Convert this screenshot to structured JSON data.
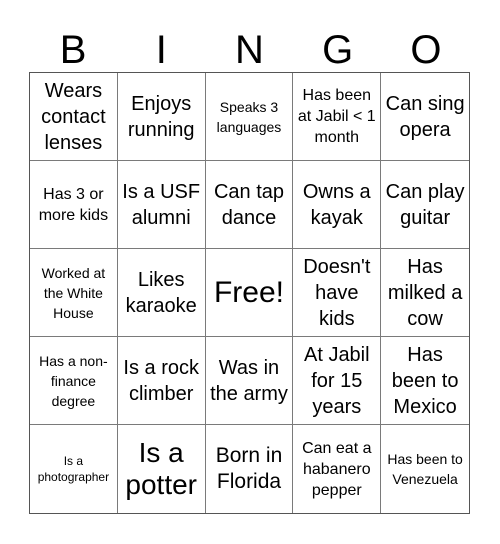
{
  "title": {
    "letters": [
      "B",
      "I",
      "N",
      "G",
      "O"
    ]
  },
  "board": {
    "rows": [
      [
        {
          "text": "Wears contact lenses",
          "size": "s-md"
        },
        {
          "text": "Enjoys running",
          "size": "s-md"
        },
        {
          "text": "Speaks 3 languages",
          "size": "s-xs"
        },
        {
          "text": "Has been at Jabil < 1 month",
          "size": "s-sm"
        },
        {
          "text": "Can sing opera",
          "size": "s-md"
        }
      ],
      [
        {
          "text": "Has 3 or more kids",
          "size": "s-sm"
        },
        {
          "text": "Is a USF alumni",
          "size": "s-md"
        },
        {
          "text": "Can tap dance",
          "size": "s-md"
        },
        {
          "text": "Owns a kayak",
          "size": "s-md"
        },
        {
          "text": "Can play guitar",
          "size": "s-md"
        }
      ],
      [
        {
          "text": "Worked at the White House",
          "size": "s-xs"
        },
        {
          "text": "Likes karaoke",
          "size": "s-md"
        },
        {
          "text": "Free!",
          "size": "s-free"
        },
        {
          "text": "Doesn't have kids",
          "size": "s-md"
        },
        {
          "text": "Has milked a cow",
          "size": "s-md"
        }
      ],
      [
        {
          "text": "Has a non-finance degree",
          "size": "s-xs"
        },
        {
          "text": "Is a rock climber",
          "size": "s-md"
        },
        {
          "text": "Was in the army",
          "size": "s-md"
        },
        {
          "text": "At Jabil for 15 years",
          "size": "s-md"
        },
        {
          "text": "Has been to Mexico",
          "size": "s-md"
        }
      ],
      [
        {
          "text": "Is a photographer",
          "size": "s-xxs"
        },
        {
          "text": "Is a potter",
          "size": "s-xl"
        },
        {
          "text": "Born in Florida",
          "size": "s-lg"
        },
        {
          "text": "Can eat a habanero pepper",
          "size": "s-sm"
        },
        {
          "text": "Has been to Venezuela",
          "size": "s-xs"
        }
      ]
    ]
  }
}
